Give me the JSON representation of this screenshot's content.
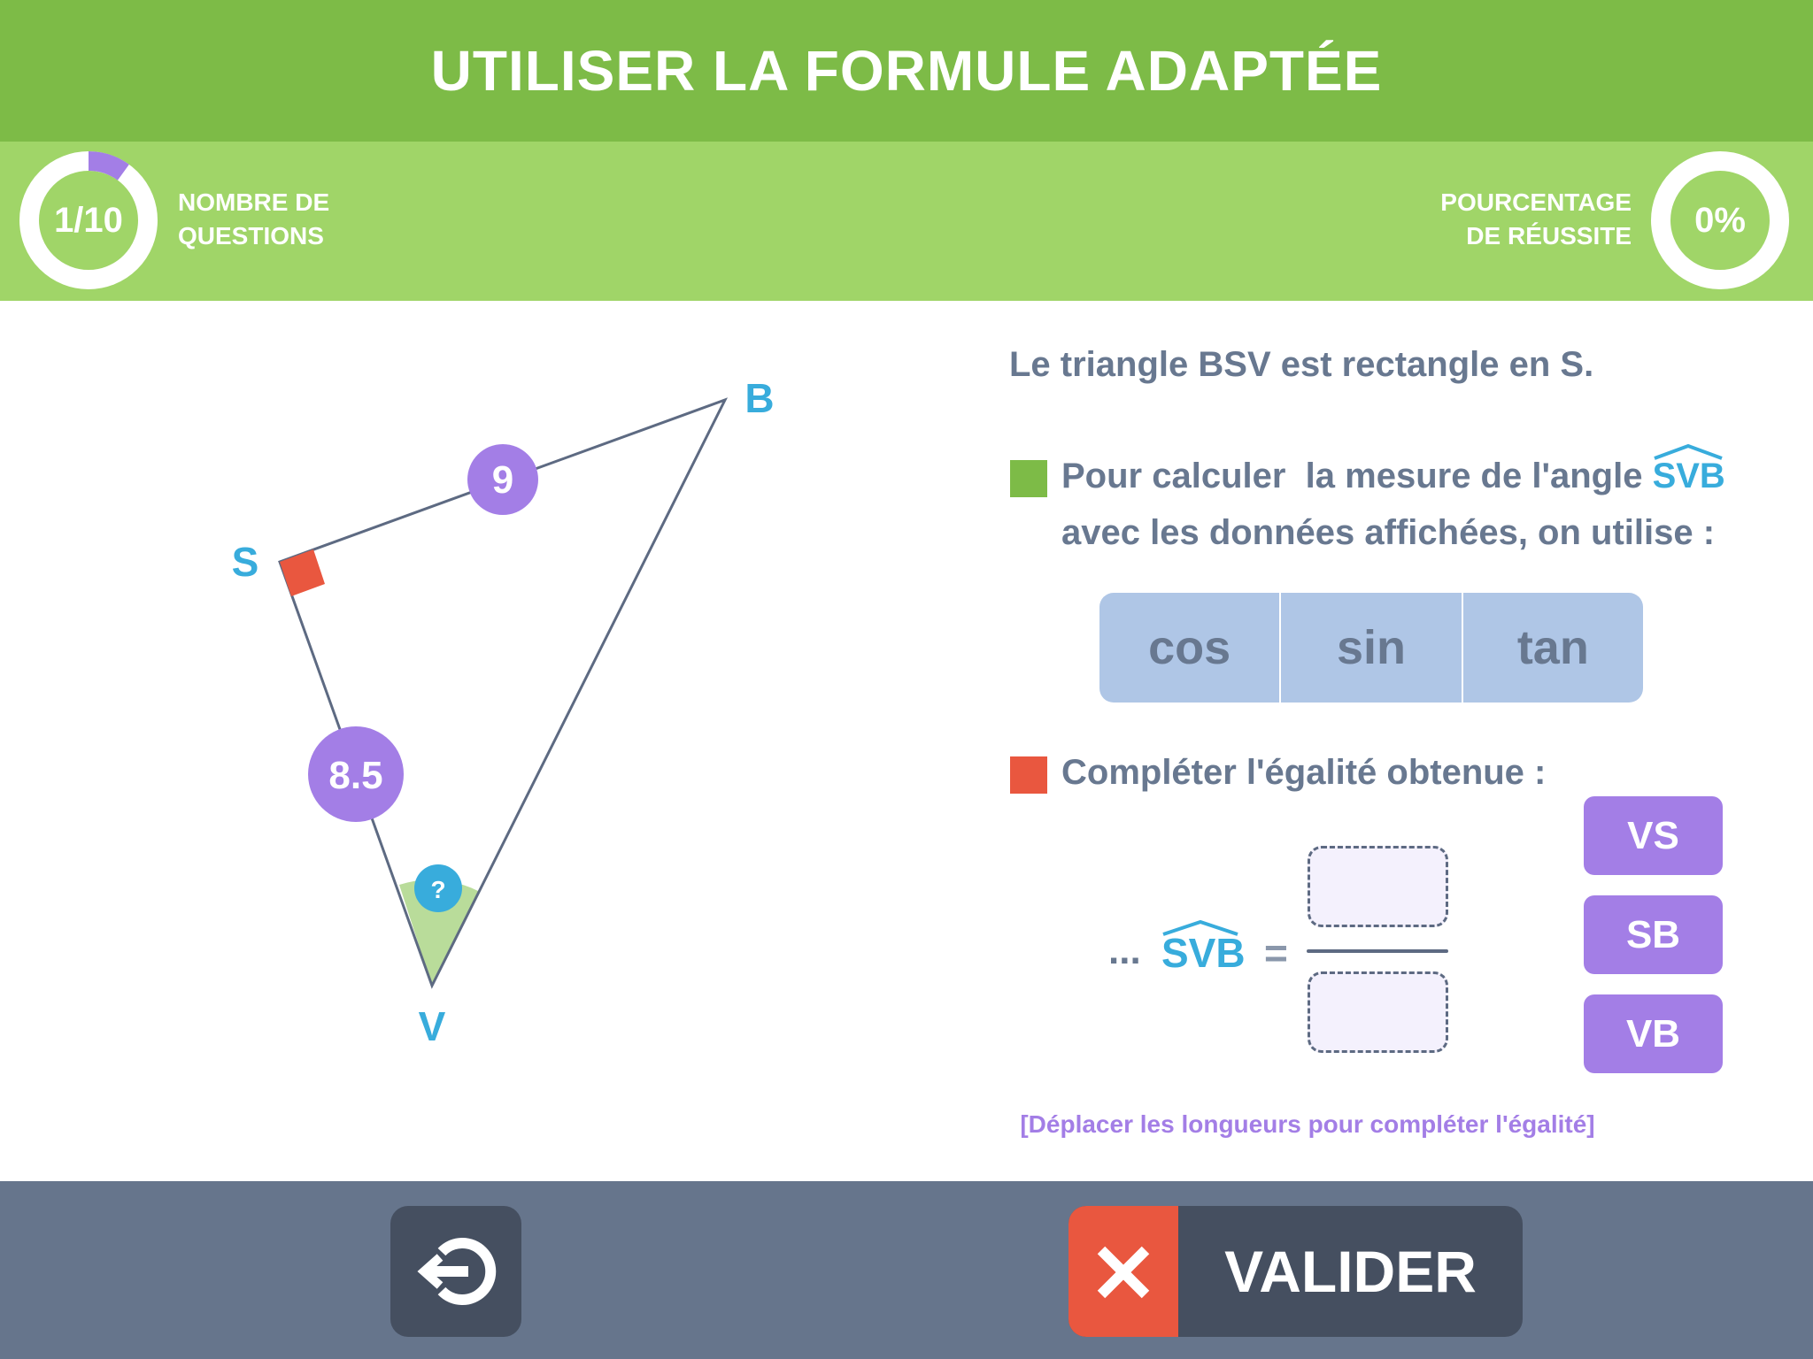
{
  "header": {
    "title": "UTILISER LA FORMULE ADAPTÉE"
  },
  "progress": {
    "value": "1/10",
    "label_line1": "NOMBRE DE",
    "label_line2": "QUESTIONS",
    "fraction": 0.1
  },
  "score": {
    "value": "0%",
    "label_line1": "POURCENTAGE",
    "label_line2": "DE RÉUSSITE",
    "fraction": 0
  },
  "figure": {
    "vertices": {
      "B": "B",
      "S": "S",
      "V": "V"
    },
    "side_SB": "9",
    "side_SV": "8.5",
    "angle_marker": "?"
  },
  "question": {
    "statement": "Le triangle BSV est rectangle en S.",
    "step1_text": "Pour calculer  la mesure de l'angle ",
    "step1_angle": "SVB",
    "step1_line2": "avec les données affichées, on utilise :",
    "trig_options": [
      "cos",
      "sin",
      "tan"
    ],
    "step2_text": "Compléter l'égalité obtenue :",
    "equation_prefix": "...",
    "equation_angle": "SVB",
    "equals": "=",
    "lengths": [
      "VS",
      "SB",
      "VB"
    ],
    "hint": "[Déplacer les longueurs pour compléter l'égalité]"
  },
  "footer": {
    "validate_label": "VALIDER",
    "back_icon": "exit-icon",
    "status_icon": "x-icon"
  },
  "colors": {
    "header": "#7dbb47",
    "bar": "#a0d568",
    "accent_purple": "#a37ee6",
    "accent_blue": "#38acdc",
    "red": "#e9573f",
    "footer": "#66758c"
  }
}
